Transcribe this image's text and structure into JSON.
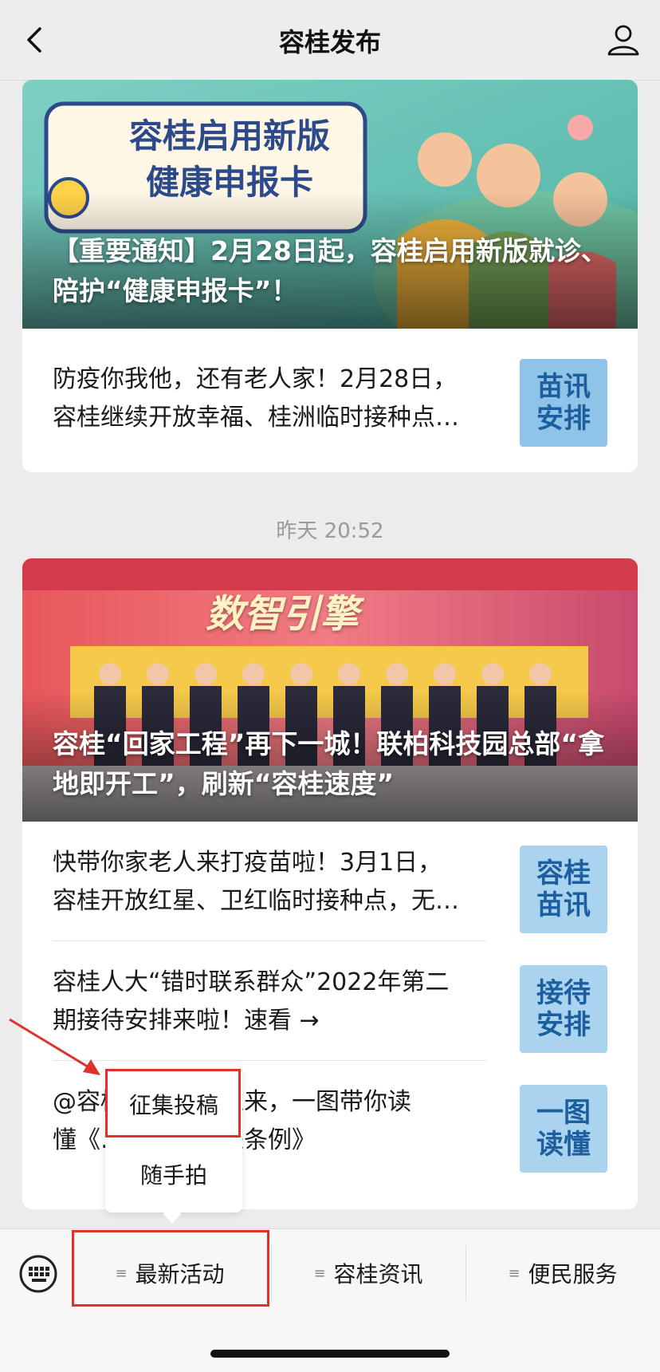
{
  "header": {
    "title": "容桂发布"
  },
  "card1": {
    "hero_title": "容桂启用新版",
    "hero_subtitle": "健康申报卡",
    "hero_caption": "【重要通知】2月28日起，容桂启用新版就诊、陪护“健康申报卡”！",
    "item": {
      "line1": "防疫你我他，还有老人家！2月28日，",
      "line2": "容桂继续开放幸福、桂洲临时接种点…",
      "thumb_top": "苗讯",
      "thumb_bottom": "安排"
    }
  },
  "timestamp": "昨天 20:52",
  "card2": {
    "hero_banner": "数智引擎",
    "hero_caption": "容桂“回家工程”再下一城！联柏科技园总部“拿地即开工”，刷新“容桂速度”",
    "items": [
      {
        "line1": "快带你家老人来打疫苗啦！3月1日，",
        "line2": "容桂开放红星、卫红临时接种点，无…",
        "thumb_top": "容桂",
        "thumb_bottom": "苗讯"
      },
      {
        "line1": "容桂人大“错时联系群众”2022年第二",
        "line2": "期接待安排来啦！速看 →",
        "thumb_top": "接待",
        "thumb_bottom": "安排"
      },
      {
        "line1": "@容桂居民，看过来，一图带你读",
        "line2": "懂《……行为促进条例》",
        "thumb_top": "一图",
        "thumb_bottom": "读懂"
      }
    ]
  },
  "popup": {
    "item1": "征集投稿",
    "item2": "随手拍"
  },
  "bottom_menu": {
    "menu1": "最新活动",
    "menu2": "容桂资讯",
    "menu3": "便民服务"
  },
  "colors": {
    "highlight": "#e0302a",
    "background": "#ececec"
  }
}
